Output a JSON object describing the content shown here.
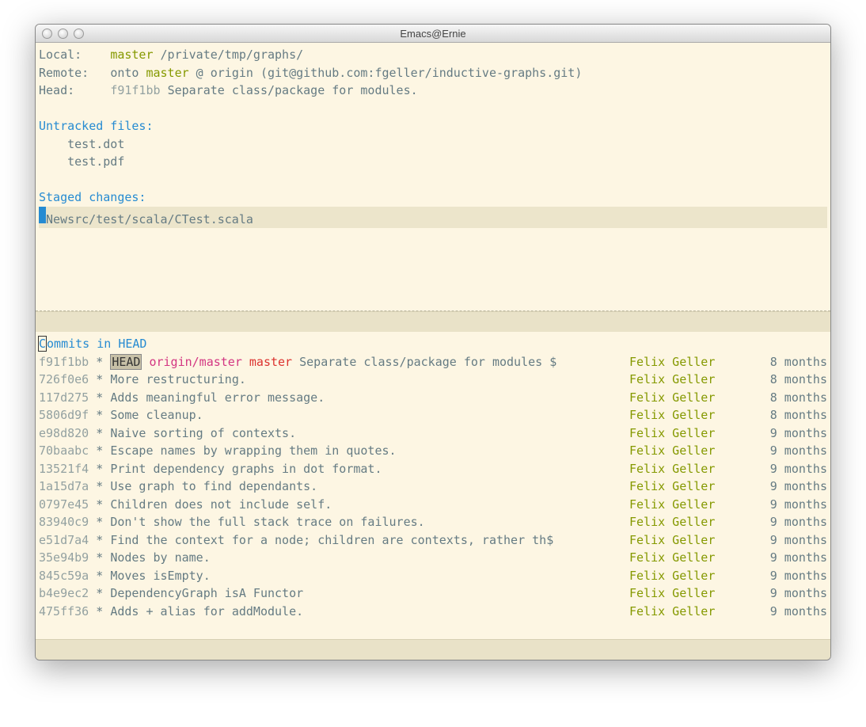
{
  "window": {
    "title": "Emacs@Ernie"
  },
  "status": {
    "local_label": "Local:",
    "local_branch": "master",
    "local_path": "/private/tmp/graphs/",
    "remote_label": "Remote:",
    "remote_prefix": "onto ",
    "remote_branch": "master",
    "remote_rest": " @ origin (git@github.com:fgeller/inductive-graphs.git)",
    "head_label": "Head:",
    "head_hash": "f91f1bb",
    "head_msg": "Separate class/package for modules."
  },
  "untracked": {
    "header": "Untracked files:",
    "files": [
      "test.dot",
      "test.pdf"
    ]
  },
  "staged": {
    "header": "Staged changes:",
    "new_label": "New",
    "file": "src/test/scala/CTest.scala"
  },
  "log": {
    "header_prefix": "C",
    "header_rest": "ommits in HEAD",
    "head_tag": "HEAD",
    "origin_ref": "origin/master",
    "master_ref": "master",
    "commits": [
      {
        "hash": "f91f1bb",
        "msg": "Separate class/package for modules $",
        "author": "Felix Geller",
        "age": "8 months",
        "is_head": true
      },
      {
        "hash": "726f0e6",
        "msg": "More restructuring.",
        "author": "Felix Geller",
        "age": "8 months"
      },
      {
        "hash": "117d275",
        "msg": "Adds meaningful error message.",
        "author": "Felix Geller",
        "age": "8 months"
      },
      {
        "hash": "5806d9f",
        "msg": "Some cleanup.",
        "author": "Felix Geller",
        "age": "8 months"
      },
      {
        "hash": "e98d820",
        "msg": "Naive sorting of contexts.",
        "author": "Felix Geller",
        "age": "9 months"
      },
      {
        "hash": "70baabc",
        "msg": "Escape names by wrapping them in quotes.",
        "author": "Felix Geller",
        "age": "9 months"
      },
      {
        "hash": "13521f4",
        "msg": "Print dependency graphs in dot format.",
        "author": "Felix Geller",
        "age": "9 months"
      },
      {
        "hash": "1a15d7a",
        "msg": "Use graph to find dependants.",
        "author": "Felix Geller",
        "age": "9 months"
      },
      {
        "hash": "0797e45",
        "msg": "Children does not include self.",
        "author": "Felix Geller",
        "age": "9 months"
      },
      {
        "hash": "83940c9",
        "msg": "Don't show the full stack trace on failures.",
        "author": "Felix Geller",
        "age": "9 months"
      },
      {
        "hash": "e51d7a4",
        "msg": "Find the context for a node; children are contexts, rather th$",
        "author": "Felix Geller",
        "age": "9 months"
      },
      {
        "hash": "35e94b9",
        "msg": "Nodes by name.",
        "author": "Felix Geller",
        "age": "9 months"
      },
      {
        "hash": "845c59a",
        "msg": "Moves isEmpty.",
        "author": "Felix Geller",
        "age": "9 months"
      },
      {
        "hash": "b4e9ec2",
        "msg": "DependencyGraph isA Functor",
        "author": "Felix Geller",
        "age": "9 months"
      },
      {
        "hash": "475ff36",
        "msg": "Adds + alias for addModule.",
        "author": "Felix Geller",
        "age": "9 months"
      }
    ]
  }
}
